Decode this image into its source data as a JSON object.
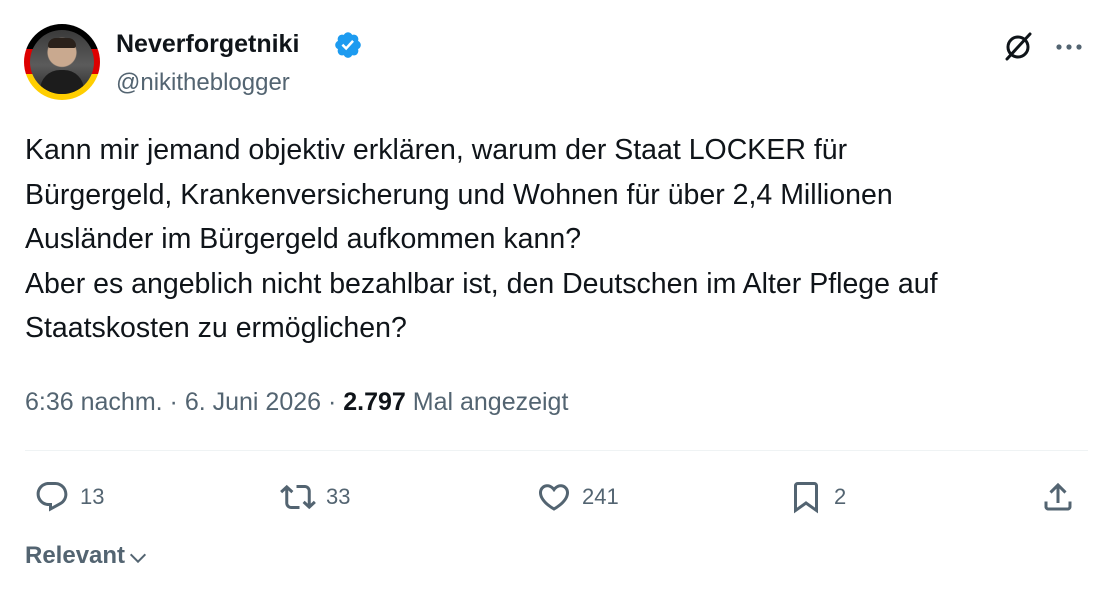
{
  "author": {
    "display_name": "Neverforgetniki",
    "handle": "@nikitheblogger",
    "verified": true,
    "avatar_ring_colors": [
      "#000000",
      "#dd0000",
      "#ffce00"
    ]
  },
  "header_icons": [
    "grok-icon",
    "more-icon"
  ],
  "tweet": {
    "lines": [
      "Kann mir jemand objektiv erklären, warum der Staat LOCKER für",
      "Bürgergeld, Krankenversicherung und Wohnen für über 2,4 Millionen",
      "Ausländer im Bürgergeld aufkommen kann?",
      "Aber es angeblich nicht bezahlbar ist, den Deutschen im Alter Pflege auf",
      "Staatskosten zu ermöglichen?"
    ]
  },
  "meta": {
    "time": "6:36 nachm.",
    "separator": " · ",
    "date": "6. Juni 2026",
    "views_count": "2.797",
    "views_label": " Mal angezeigt"
  },
  "actions": {
    "reply_count": "13",
    "retweet_count": "33",
    "like_count": "241",
    "bookmark_count": "2"
  },
  "sort": {
    "label": "Relevant"
  },
  "colors": {
    "text_primary": "#0f1419",
    "text_secondary": "#536471",
    "verified_blue": "#1d9bf0",
    "divider": "#eff3f4"
  }
}
